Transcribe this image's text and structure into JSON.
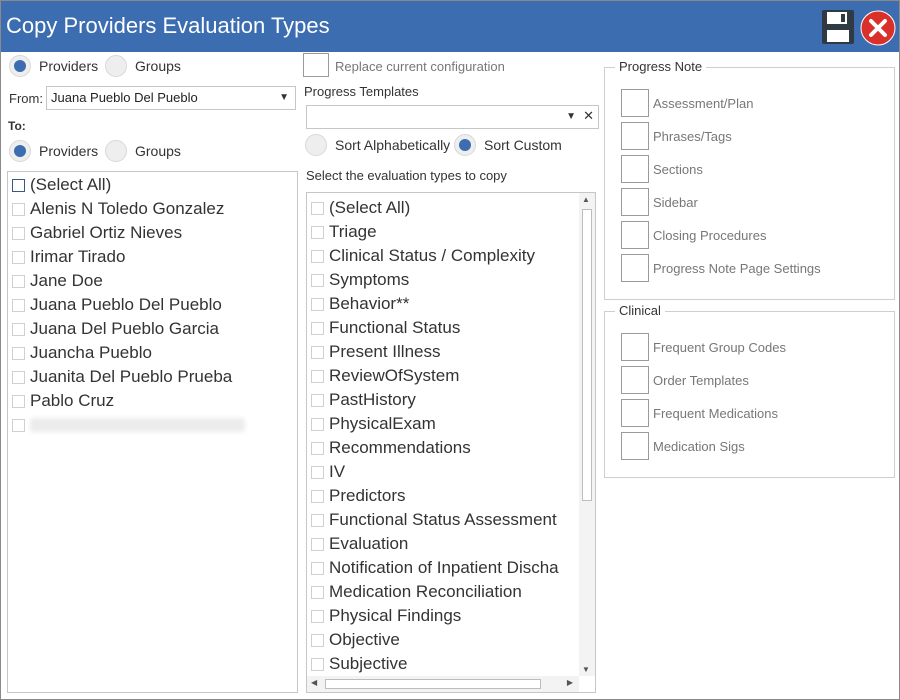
{
  "window": {
    "title": "Copy Providers Evaluation Types"
  },
  "from_section": {
    "radio_providers": "Providers",
    "radio_groups": "Groups",
    "from_label": "From:",
    "from_value": "Juana Pueblo Del Pueblo"
  },
  "to_section": {
    "label": "To:",
    "radio_providers": "Providers",
    "radio_groups": "Groups"
  },
  "providers_list": [
    "(Select All)",
    "Alenis N Toledo Gonzalez",
    "Gabriel Ortiz Nieves",
    "Irimar Tirado",
    "Jane Doe",
    "Juana Pueblo Del Pueblo",
    "Juana Del Pueblo Garcia",
    "Juancha Pueblo",
    "Juanita Del Pueblo Prueba",
    "Pablo Cruz"
  ],
  "middle": {
    "replace_label": "Replace current configuration",
    "templates_label": "Progress Templates",
    "sort_alpha": "Sort Alphabetically",
    "sort_custom": "Sort Custom",
    "select_label": "Select the evaluation types to copy"
  },
  "evaluation_types": [
    "(Select All)",
    "Triage",
    "Clinical Status / Complexity",
    "Symptoms",
    "Behavior**",
    "Functional Status",
    "Present Illness",
    "ReviewOfSystem",
    "PastHistory",
    "PhysicalExam",
    "Recommendations",
    "IV",
    "Predictors",
    "Functional Status Assessment",
    "Evaluation",
    "Notification of Inpatient Discha",
    "Medication Reconciliation",
    "Physical Findings",
    "Objective",
    "Subjective"
  ],
  "progress_note": {
    "legend": "Progress Note",
    "options": [
      "Assessment/Plan",
      "Phrases/Tags",
      "Sections",
      "Sidebar",
      "Closing Procedures",
      "Progress Note Page Settings"
    ]
  },
  "clinical": {
    "legend": "Clinical",
    "options": [
      "Frequent Group Codes",
      "Order Templates",
      "Frequent Medications",
      "Medication Sigs"
    ]
  },
  "colors": {
    "titlebar": "#3b6db0",
    "accent": "#3b6db0",
    "close": "#d9302a"
  },
  "icons": {
    "save": "floppy-disk-icon",
    "close": "close-icon",
    "dropdown": "chevron-down-icon",
    "clear": "clear-x-icon"
  }
}
